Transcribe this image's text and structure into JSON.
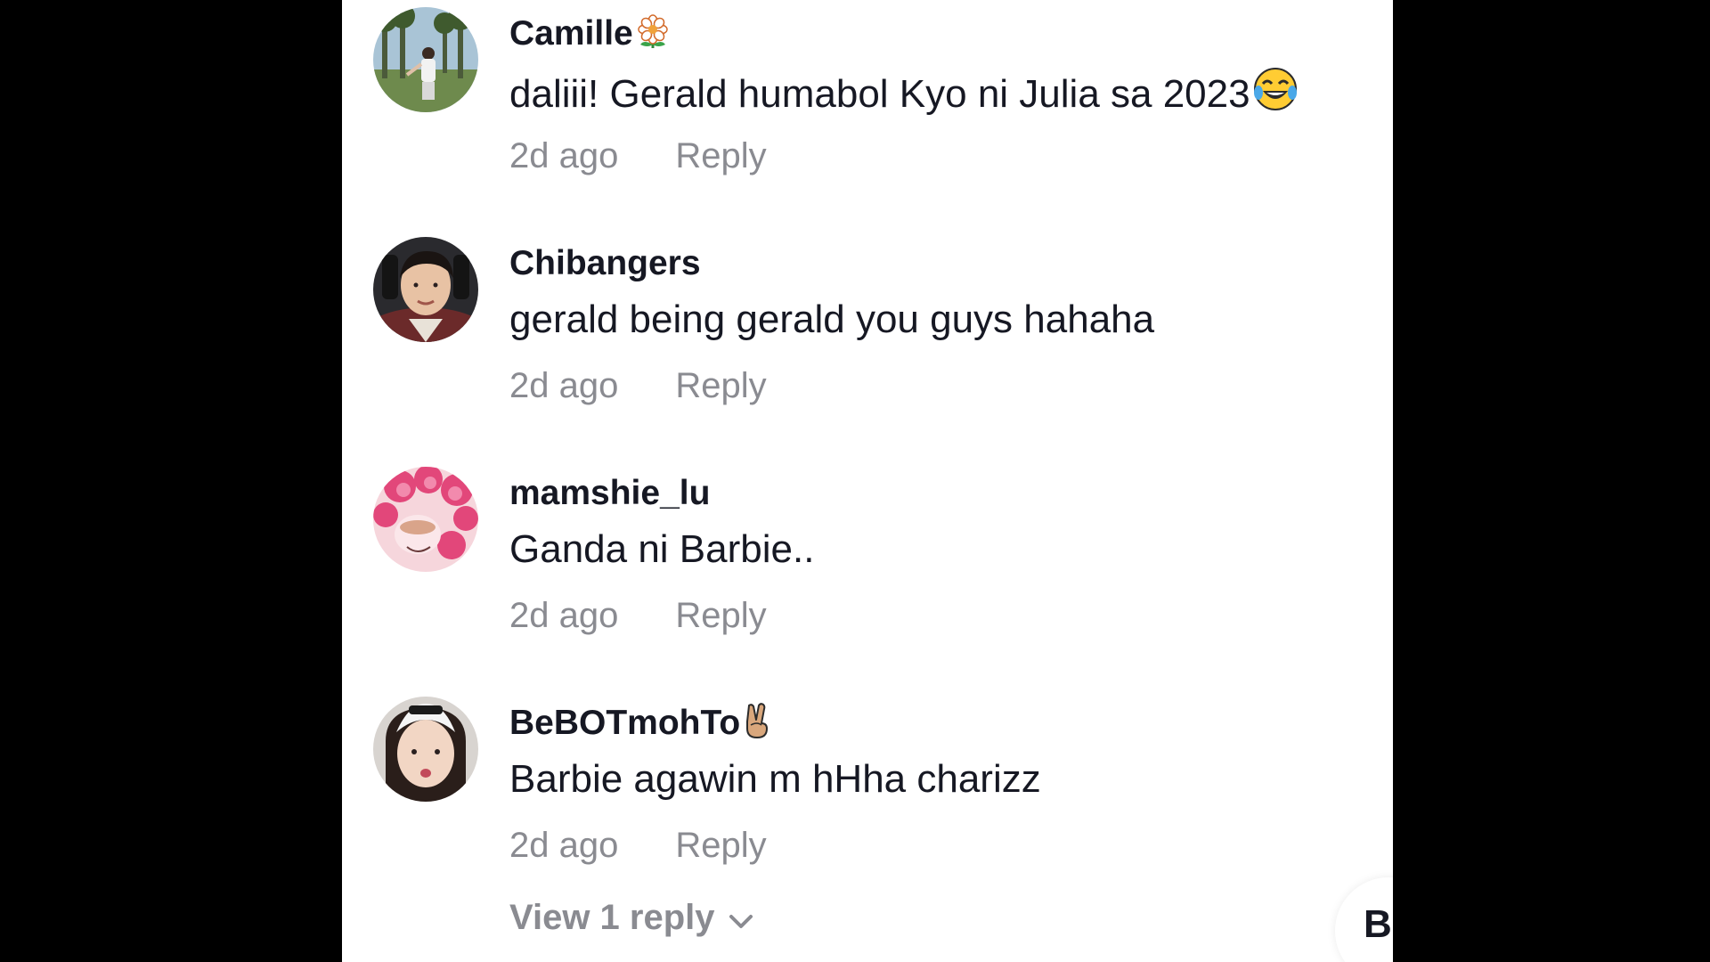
{
  "comments": [
    {
      "username": "Camille",
      "username_emoji": "flower-icon",
      "text": "daliii! Gerald humabol Kyo ni Julia sa 2023",
      "text_emoji": "laughing-tears-icon",
      "time": "2d ago",
      "reply_label": "Reply"
    },
    {
      "username": "Chibangers",
      "text": "gerald being gerald you guys hahaha",
      "time": "2d ago",
      "reply_label": "Reply"
    },
    {
      "username": "mamshie_lu",
      "text": "Ganda ni Barbie..",
      "time": "2d ago",
      "reply_label": "Reply"
    },
    {
      "username": "BeBOTmohTo",
      "username_emoji": "victory-hand-icon",
      "text": "Barbie agawin m hHha charizz",
      "time": "2d ago",
      "reply_label": "Reply",
      "view_replies_label": "View 1 reply"
    }
  ],
  "partial_button_text": "B",
  "colors": {
    "background": "#000000",
    "panel": "#ffffff",
    "text_primary": "#161823",
    "text_secondary": "#8a8b91"
  }
}
